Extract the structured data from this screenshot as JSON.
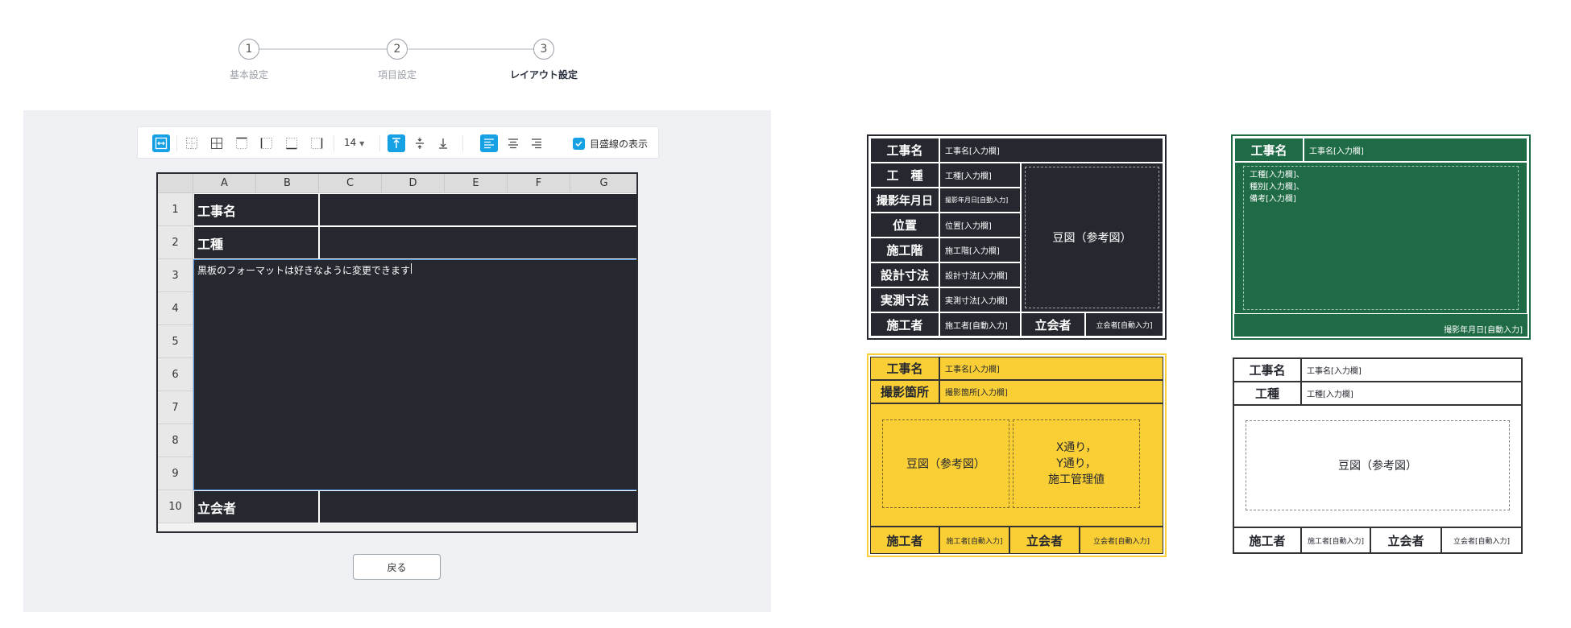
{
  "steps": [
    {
      "num": "1",
      "label": "基本設定"
    },
    {
      "num": "2",
      "label": "項目設定"
    },
    {
      "num": "3",
      "label": "レイアウト設定"
    }
  ],
  "toolbar": {
    "font_size": "14",
    "gridline_label": "目盛線の表示",
    "gridline_checked": true,
    "accent": "#16a1e5"
  },
  "sheet": {
    "columns": [
      "A",
      "B",
      "C",
      "D",
      "E",
      "F",
      "G"
    ],
    "rows": [
      "1",
      "2",
      "3",
      "4",
      "5",
      "6",
      "7",
      "8",
      "9",
      "10"
    ],
    "cells": {
      "r1_label": "工事名",
      "r2_label": "工種",
      "r3_text": "黒板のフォーマットは好きなように変更できます",
      "r10_label": "立会者"
    }
  },
  "back_button": "戻る",
  "templates": {
    "dark": {
      "bg": "#262830",
      "rows": [
        {
          "label": "工事名",
          "value": "工事名[入力欄]"
        },
        {
          "label": "工　種",
          "value": "工種[入力欄]"
        },
        {
          "label": "撮影年月日",
          "value": "撮影年月日[自動入力]"
        },
        {
          "label": "位置",
          "value": "位置[入力欄]"
        },
        {
          "label": "施工階",
          "value": "施工階[入力欄]"
        },
        {
          "label": "設計寸法",
          "value": "設計寸法[入力欄]"
        },
        {
          "label": "実測寸法",
          "value": "実測寸法[入力欄]"
        }
      ],
      "figure": "豆図（参考図）",
      "footer": {
        "builder_label": "施工者",
        "builder_value": "施工者[自動入力]",
        "witness_label": "立会者",
        "witness_value": "立会者[自動入力]"
      }
    },
    "green": {
      "bg": "#1f6b45",
      "title_label": "工事名",
      "title_value": "工事名[入力欄]",
      "body_lines": [
        "工種[入力欄]、",
        "種別[入力欄]、",
        "備考[入力欄]"
      ],
      "footer_value": "撮影年月日[自動入力]"
    },
    "yellow": {
      "bg": "#f9cf35",
      "rows": [
        {
          "label": "工事名",
          "value": "工事名[入力欄]"
        },
        {
          "label": "撮影箇所",
          "value": "撮影箇所[入力欄]"
        }
      ],
      "figure": "豆図（参考図）",
      "axis_lines": [
        "X通り，",
        "Y通り，",
        "施工管理値"
      ],
      "footer": {
        "builder_label": "施工者",
        "builder_value": "施工者[自動入力]",
        "witness_label": "立会者",
        "witness_value": "立会者[自動入力]"
      }
    },
    "white": {
      "bg": "#ffffff",
      "rows": [
        {
          "label": "工事名",
          "value": "工事名[入力欄]"
        },
        {
          "label": "工種",
          "value": "工種[入力欄]"
        }
      ],
      "figure": "豆図（参考図）",
      "footer": {
        "builder_label": "施工者",
        "builder_value": "施工者[自動入力]",
        "witness_label": "立会者",
        "witness_value": "立会者[自動入力]"
      }
    }
  }
}
